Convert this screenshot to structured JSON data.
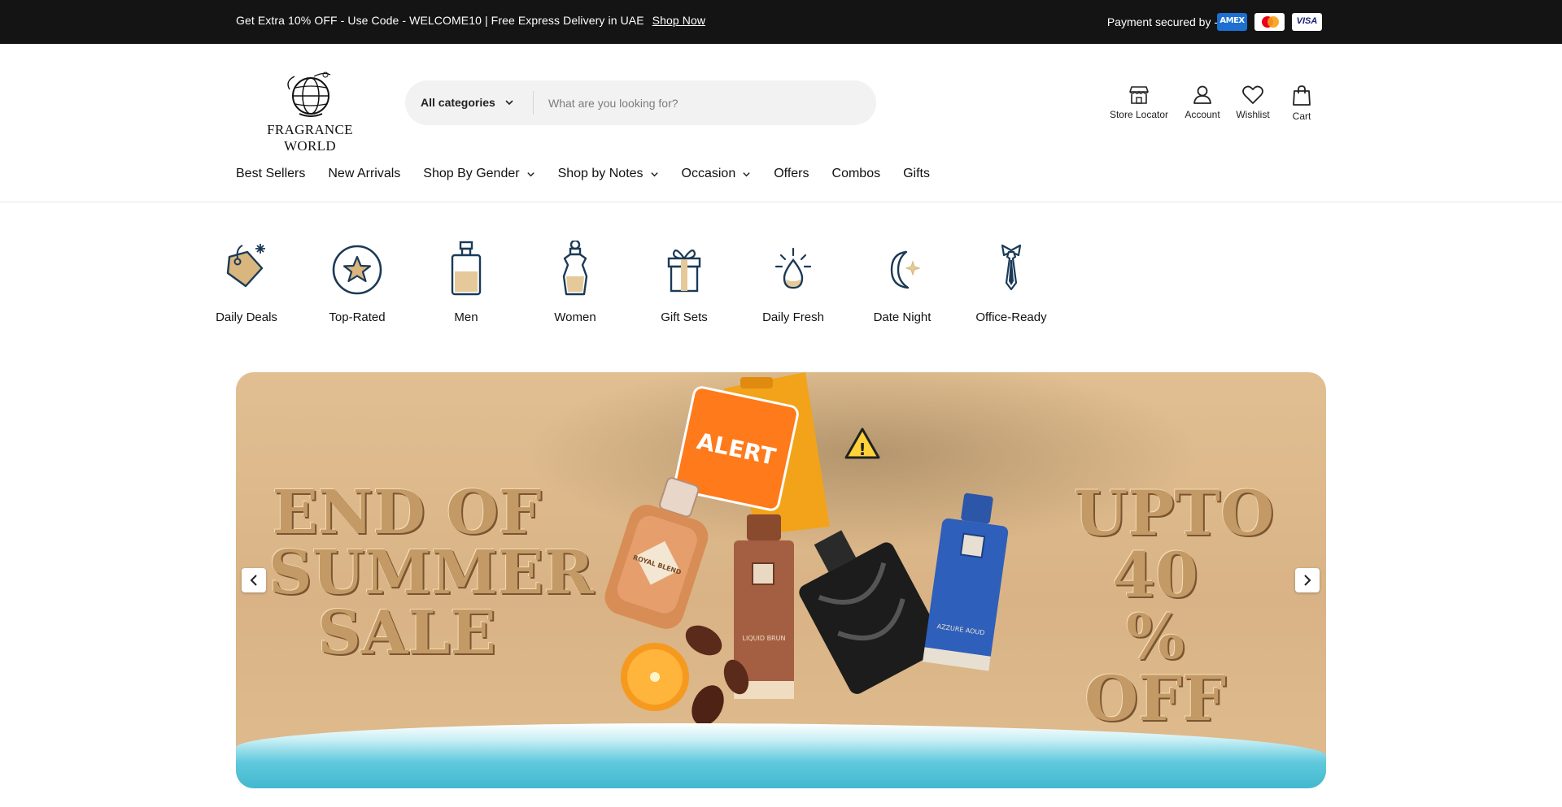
{
  "announcement": {
    "promo_text": "Get Extra 10% OFF - Use Code - WELCOME10 | Free Express Delivery in UAE",
    "promo_link": "Shop Now",
    "payment_text": "Payment secured by -",
    "cards": [
      {
        "name": "American Express",
        "label": "AMEX"
      },
      {
        "name": "Mastercard",
        "label": ""
      },
      {
        "name": "Visa",
        "label": "VISA"
      }
    ]
  },
  "header": {
    "logo_text": "FRAGRANCE WORLD",
    "search": {
      "category_label": "All categories",
      "placeholder": "What are you looking for?",
      "value": ""
    },
    "icons": {
      "store_locator": "Store Locator",
      "account": "Account",
      "wishlist": "Wishlist",
      "cart": "Cart"
    }
  },
  "nav": {
    "items": [
      {
        "label": "Best Sellers",
        "dropdown": false
      },
      {
        "label": "New Arrivals",
        "dropdown": false
      },
      {
        "label": "Shop By Gender",
        "dropdown": true
      },
      {
        "label": "Shop by Notes",
        "dropdown": true
      },
      {
        "label": "Occasion",
        "dropdown": true
      },
      {
        "label": "Offers",
        "dropdown": false
      },
      {
        "label": "Combos",
        "dropdown": false
      },
      {
        "label": "Gifts",
        "dropdown": false
      }
    ]
  },
  "categories": [
    {
      "label": "Daily Deals",
      "icon": "price-tag-icon"
    },
    {
      "label": "Top-Rated",
      "icon": "star-icon"
    },
    {
      "label": "Men",
      "icon": "men-perfume-bottle-icon"
    },
    {
      "label": "Women",
      "icon": "women-perfume-bottle-icon"
    },
    {
      "label": "Gift Sets",
      "icon": "gift-box-icon"
    },
    {
      "label": "Daily Fresh",
      "icon": "fresh-drop-icon"
    },
    {
      "label": "Date Night",
      "icon": "moon-icon"
    },
    {
      "label": "Office-Ready",
      "icon": "tie-icon"
    }
  ],
  "hero": {
    "headline_left": "END OF SUMMER SALE",
    "headline_right": "UPTO 40 % OFF",
    "sign_text": "ALERT",
    "bottle_labels": [
      "ROYAL BLEND",
      "LIQUID BRUN",
      "AZZURE AOUD"
    ]
  },
  "colors": {
    "topbar_bg": "#141414",
    "icon_navy": "#1b3a57",
    "icon_gold": "#d9b67e",
    "search_bg": "#f2f2f2"
  }
}
